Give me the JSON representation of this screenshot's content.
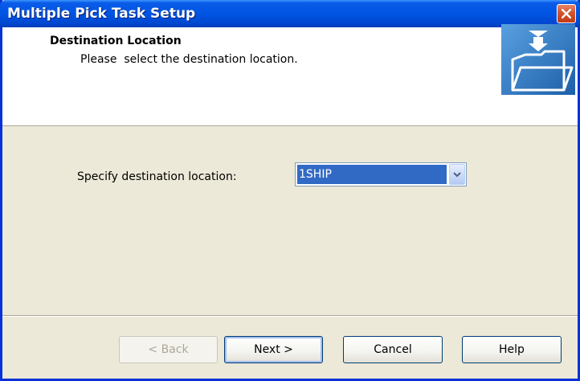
{
  "window": {
    "title": "Multiple Pick Task Setup"
  },
  "header": {
    "title": "Destination Location",
    "subtitle": "Please  select the destination location."
  },
  "form": {
    "destination_label": "Specify destination location:",
    "destination_value": "1SHIP"
  },
  "buttons": {
    "back": "< Back",
    "next": "Next >",
    "cancel": "Cancel",
    "help": "Help"
  },
  "colors": {
    "titlebar": "#0054e3",
    "window_bg": "#ece9d8",
    "selection": "#316ac5",
    "close": "#d2542f"
  },
  "icons": {
    "close": "close-icon",
    "header": "folder-download-icon",
    "dropdown": "chevron-down-icon"
  }
}
